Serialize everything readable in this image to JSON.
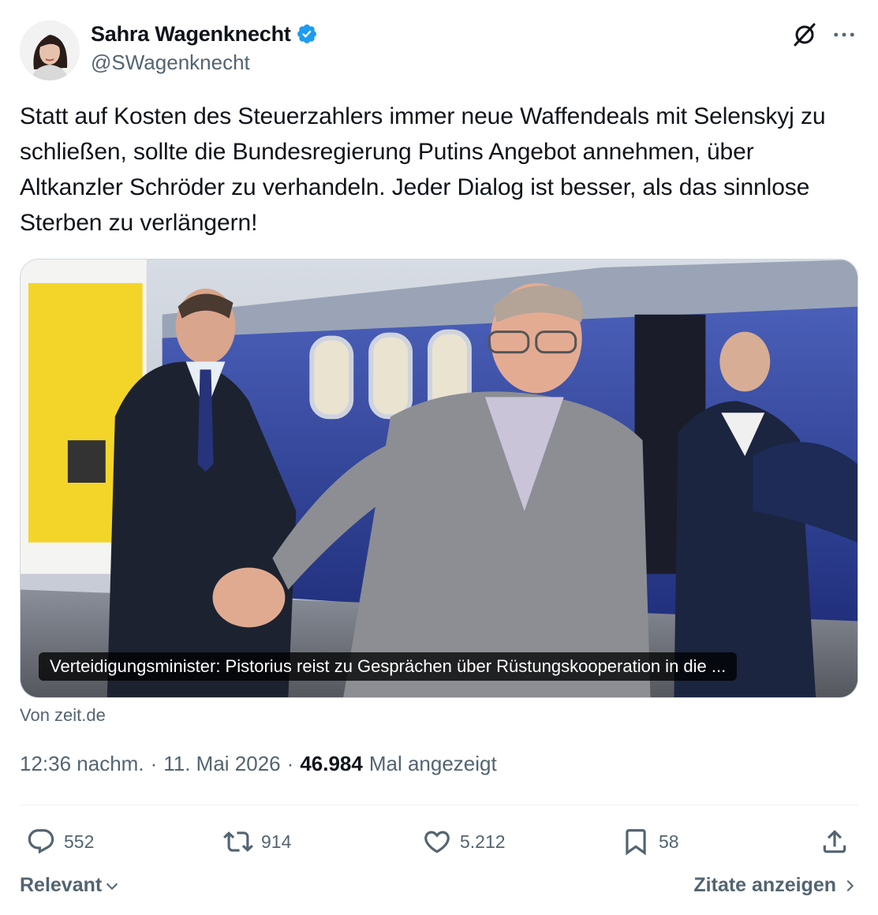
{
  "author": {
    "display_name": "Sahra Wagenknecht",
    "handle": "@SWagenknecht",
    "verified": true
  },
  "header_icons": [
    "grok-icon",
    "more-icon"
  ],
  "tweet": {
    "text": "Statt auf Kosten des Steuerzahlers immer neue Waffendeals mit Selenskyj zu schließen, sollte die Bundesregierung Putins Angebot annehmen, über Altkanzler Schröder zu verhandeln. Jeder Dialog ist besser, als das sinnlose Sterben zu verlängern!"
  },
  "link_card": {
    "caption": "Verteidigungsminister: Pistorius reist zu Gesprächen über Rüstungskooperation in die ...",
    "source": "Von zeit.de"
  },
  "meta": {
    "time": "12:36 nachm.",
    "separator": "·",
    "date": "11. Mai 2026",
    "views": "46.984",
    "views_label": "Mal angezeigt"
  },
  "actions": {
    "replies": "552",
    "reposts": "914",
    "likes": "5.212",
    "bookmarks": "58"
  },
  "footer": {
    "sort_label": "Relevant",
    "quotes_label": "Zitate anzeigen"
  },
  "colors": {
    "text_primary": "#0f1419",
    "text_secondary": "#536471",
    "verified_blue": "#1d9bf0",
    "divider": "#eff3f4"
  }
}
